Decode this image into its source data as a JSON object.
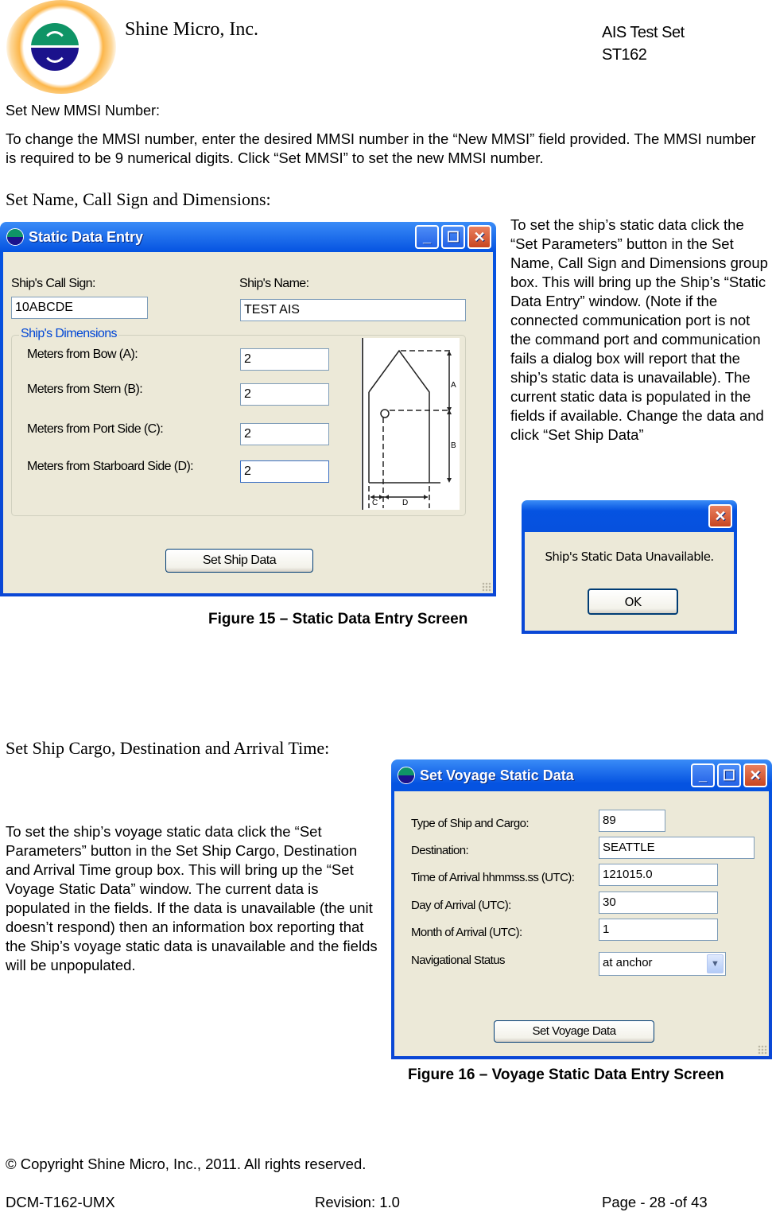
{
  "header": {
    "company": "Shine Micro, Inc.",
    "product_line1": "AIS Test Set",
    "product_line2": "ST162"
  },
  "section_mmsi": {
    "heading": "Set New MMSI Number:",
    "body": "To change the MMSI number, enter the desired MMSI number in the “New MMSI” field provided.  The MMSI number is required to be 9 numerical digits.  Click “Set MMSI” to set the new MMSI number."
  },
  "section_static": {
    "heading": "Set Name, Call Sign and Dimensions:",
    "body": "To set the ship’s static data click the “Set Parameters” button in the Set Name, Call Sign and Dimensions group box.  This will bring up the Ship’s “Static Data Entry” window.  (Note if the connected communication port is not the command port and communication fails a dialog box will report that the ship’s static data is unavailable). The current static data is populated in the fields if available.  Change the data and click “Set Ship Data”",
    "caption": "Figure 15 – Static Data Entry Screen"
  },
  "static_window": {
    "title": "Static Data Entry",
    "call_sign_label": "Ship's Call Sign:",
    "call_sign_value": "10ABCDE",
    "name_label": "Ship's Name:",
    "name_value": "TEST AIS",
    "group_title": "Ship's Dimensions",
    "fields": [
      {
        "label": "Meters from Bow (A):",
        "value": "2"
      },
      {
        "label": "Meters from Stern (B):",
        "value": "2"
      },
      {
        "label": "Meters from Port Side (C):",
        "value": "2"
      },
      {
        "label": "Meters from Starboard Side (D):",
        "value": "2"
      }
    ],
    "diagram_labels": {
      "a": "A",
      "b": "B",
      "c": "C",
      "d": "D"
    },
    "button": "Set Ship Data"
  },
  "dialog": {
    "message": "Ship's Static Data Unavailable.",
    "ok": "OK"
  },
  "section_voyage": {
    "heading": "Set Ship Cargo, Destination and Arrival Time:",
    "body": "To set the ship’s voyage static data click the “Set Parameters” button in the Set Ship Cargo, Destination and Arrival  Time group box.  This will bring up the “Set Voyage Static Data” window.  The current data is populated in the fields.  If the data is unavailable (the unit doesn’t respond) then an information box  reporting that the Ship’s voyage static data is unavailable and the fields will be unpopulated.",
    "caption": "Figure 16 – Voyage Static Data Entry Screen"
  },
  "voyage_window": {
    "title": "Set Voyage Static Data",
    "fields": [
      {
        "label": "Type of Ship and Cargo:",
        "value": "89"
      },
      {
        "label": "Destination:",
        "value": "SEATTLE"
      },
      {
        "label": "Time of Arrival hhmmss.ss (UTC):",
        "value": "121015.0"
      },
      {
        "label": "Day of Arrival (UTC):",
        "value": "30"
      },
      {
        "label": "Month of Arrival (UTC):",
        "value": "1"
      }
    ],
    "nav_label": "Navigational Status",
    "nav_value": "at anchor",
    "button": "Set Voyage Data"
  },
  "footer": {
    "copyright": "© Copyright Shine Micro, Inc., 2011.  All rights reserved.",
    "doc_id": "DCM-T162-UMX",
    "revision": "Revision: 1.0",
    "page": "Page - 28 -of 43"
  },
  "window_controls": {
    "minimize": "_",
    "maximize": "☐",
    "close": "✕"
  }
}
